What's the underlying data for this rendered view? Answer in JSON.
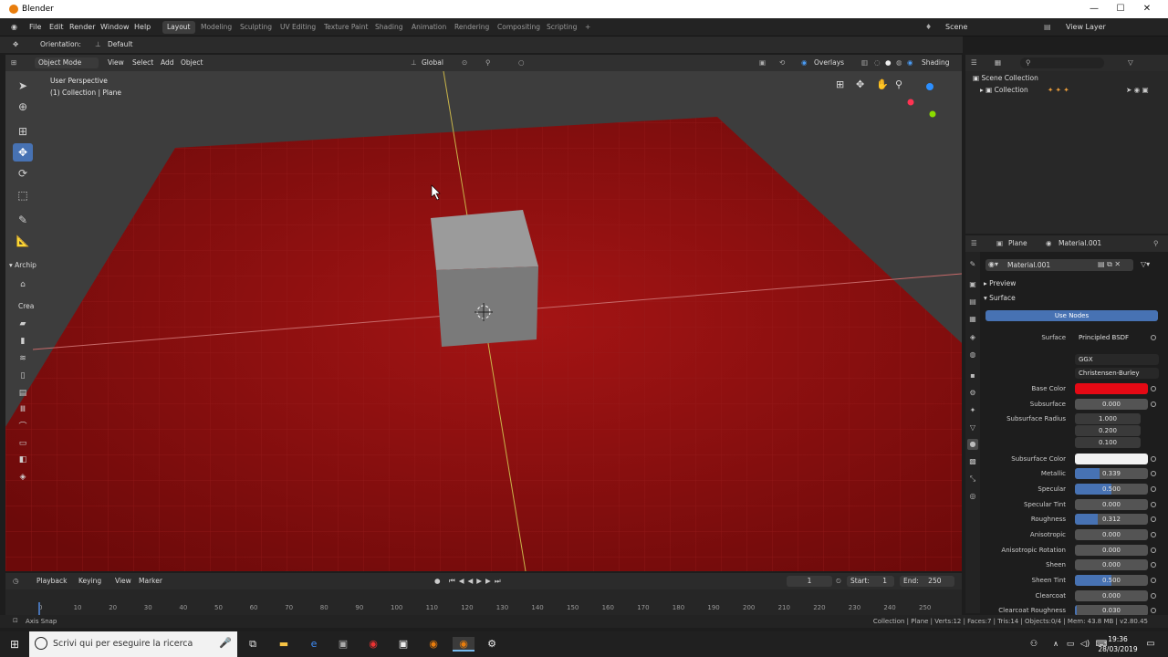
{
  "window": {
    "title": "Blender",
    "minimize": "—",
    "maximize": "☐",
    "close": "✕"
  },
  "menu": {
    "items": [
      "File",
      "Edit",
      "Render",
      "Window",
      "Help"
    ],
    "workspaces": [
      "Layout",
      "Modeling",
      "Sculpting",
      "UV Editing",
      "Texture Paint",
      "Shading",
      "Animation",
      "Rendering",
      "Compositing",
      "Scripting"
    ],
    "add_tab": "+",
    "scene": "Scene",
    "view_layer": "View Layer"
  },
  "tool_settings": {
    "orientation_label": "Orientation:",
    "orientation_value": "Default"
  },
  "viewport_header": {
    "mode": "Object Mode",
    "view": "View",
    "select": "Select",
    "add": "Add",
    "object": "Object",
    "transform": "Global",
    "overlays": "Overlays",
    "shading": "Shading"
  },
  "viewport": {
    "perspective": "User Perspective",
    "collection_info": "(1) Collection | Plane",
    "panel_title": "Archip",
    "panel_sub": "Crea"
  },
  "outliner": {
    "scene_collection": "Scene Collection",
    "collection": "Collection"
  },
  "properties": {
    "object": "Plane",
    "material_header": "Material.001",
    "material_slot": "Material.001",
    "preview": "Preview",
    "surface_panel": "Surface",
    "use_nodes": "Use Nodes",
    "surface_label": "Surface",
    "surface_value": "Principled BSDF",
    "distribution": "GGX",
    "subsurface_method": "Christensen-Burley",
    "base_color_label": "Base Color",
    "base_color": "#e50914",
    "rows": [
      {
        "label": "Subsurface",
        "value": "0.000",
        "fill": 0
      },
      {
        "label": "Subsurface Radius",
        "value": "1.000",
        "fill": 0
      },
      {
        "label": "",
        "value": "0.200",
        "fill": 0
      },
      {
        "label": "",
        "value": "0.100",
        "fill": 0
      },
      {
        "label": "Subsurface Color",
        "value": "",
        "fill": 0
      },
      {
        "label": "Metallic",
        "value": "0.339",
        "fill": 0.339
      },
      {
        "label": "Specular",
        "value": "0.500",
        "fill": 0.5
      },
      {
        "label": "Specular Tint",
        "value": "0.000",
        "fill": 0
      },
      {
        "label": "Roughness",
        "value": "0.312",
        "fill": 0.312
      },
      {
        "label": "Anisotropic",
        "value": "0.000",
        "fill": 0
      },
      {
        "label": "Anisotropic Rotation",
        "value": "0.000",
        "fill": 0
      },
      {
        "label": "Sheen",
        "value": "0.000",
        "fill": 0
      },
      {
        "label": "Sheen Tint",
        "value": "0.500",
        "fill": 0.5
      },
      {
        "label": "Clearcoat",
        "value": "0.000",
        "fill": 0
      },
      {
        "label": "Clearcoat Roughness",
        "value": "0.030",
        "fill": 0.03
      }
    ]
  },
  "timeline": {
    "playback": "Playback",
    "keying": "Keying",
    "view": "View",
    "marker": "Marker",
    "current_frame": "1",
    "start_label": "Start:",
    "start": "1",
    "end_label": "End:",
    "end": "250",
    "ticks": [
      "0",
      "10",
      "20",
      "30",
      "40",
      "50",
      "60",
      "70",
      "80",
      "90",
      "100",
      "110",
      "120",
      "130",
      "140",
      "150",
      "160",
      "170",
      "180",
      "190",
      "200",
      "210",
      "220",
      "230",
      "240",
      "250"
    ]
  },
  "status": {
    "left": "Axis Snap",
    "right": "Collection | Plane | Verts:12 | Faces:7 | Tris:14 | Objects:0/4 | Mem: 43.8 MB | v2.80.45"
  },
  "taskbar": {
    "search_placeholder": "Scrivi qui per eseguire la ricerca",
    "time": "19:36",
    "date": "28/03/2019"
  }
}
